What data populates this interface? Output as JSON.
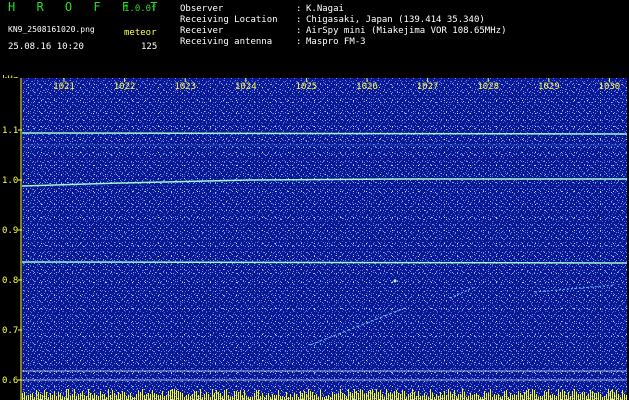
{
  "header": {
    "app_title": "H R O F F T",
    "version": "1.0.0f",
    "filename": "KN9_2508161020.png",
    "mode": "meteor",
    "datetime": "25.08.16 10:20",
    "count": "125",
    "info": [
      {
        "label": "Observer",
        "value": "K.Nagai"
      },
      {
        "label": "Receiving Location",
        "value": "Chigasaki, Japan (139.414 35.340)"
      },
      {
        "label": "Receiver",
        "value": "AirSpy mini (Miakejima VOR 108.65MHz)"
      },
      {
        "label": "Receiving antenna",
        "value": "Maspro FM-3"
      }
    ],
    "separator": ":"
  },
  "axes": {
    "y_unit": "kHz",
    "y_ticks": [
      "1.1",
      "1.0",
      "0.9",
      "0.8",
      "0.7",
      "0.6"
    ],
    "x_ticks": [
      "1021",
      "1022",
      "1023",
      "1024",
      "1025",
      "1026",
      "1027",
      "1028",
      "1029",
      "1030"
    ]
  },
  "colors": {
    "background": "#0d1890",
    "noise": "#4a7cff",
    "trace": "#9ff7c9",
    "label_green": "#22e022",
    "label_yellow": "#ffff44",
    "bottom_bar": "#ffff00"
  }
}
